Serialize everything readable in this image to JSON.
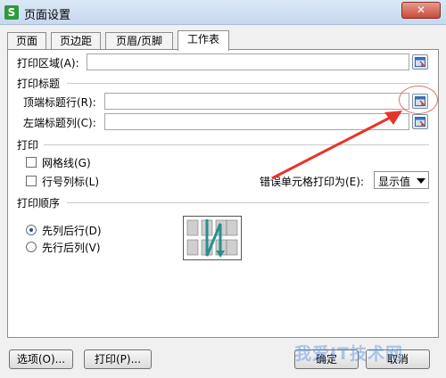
{
  "window": {
    "title": "页面设置",
    "app_icon_letter": "S",
    "close_glyph": "✕"
  },
  "tabs": [
    {
      "label": "页面"
    },
    {
      "label": "页边距"
    },
    {
      "label": "页眉/页脚"
    },
    {
      "label": "工作表"
    }
  ],
  "sheet": {
    "print_area_label": "打印区域(A):",
    "print_area_value": "",
    "print_titles_heading": "打印标题",
    "top_rows_label": "顶端标题行(R):",
    "top_rows_value": "",
    "left_cols_label": "左端标题列(C):",
    "left_cols_value": "",
    "print_heading": "打印",
    "gridlines_label": "网格线(G)",
    "gridlines_checked": false,
    "row_col_headers_label": "行号列标(L)",
    "row_col_headers_checked": false,
    "error_cells_label": "错误单元格打印为(E):",
    "error_cells_value": "显示值",
    "order_heading": "打印顺序",
    "order_options": [
      {
        "label": "先列后行(D)",
        "checked": true
      },
      {
        "label": "先行后列(V)",
        "checked": false
      }
    ]
  },
  "buttons": {
    "options": "选项(O)...",
    "print": "打印(P)...",
    "ok": "确定",
    "cancel": "取消"
  },
  "watermark": "我爱IT技术网",
  "colors": {
    "accent_annotation": "#e8332a",
    "order_preview_arrow": "#2a8f8a"
  }
}
